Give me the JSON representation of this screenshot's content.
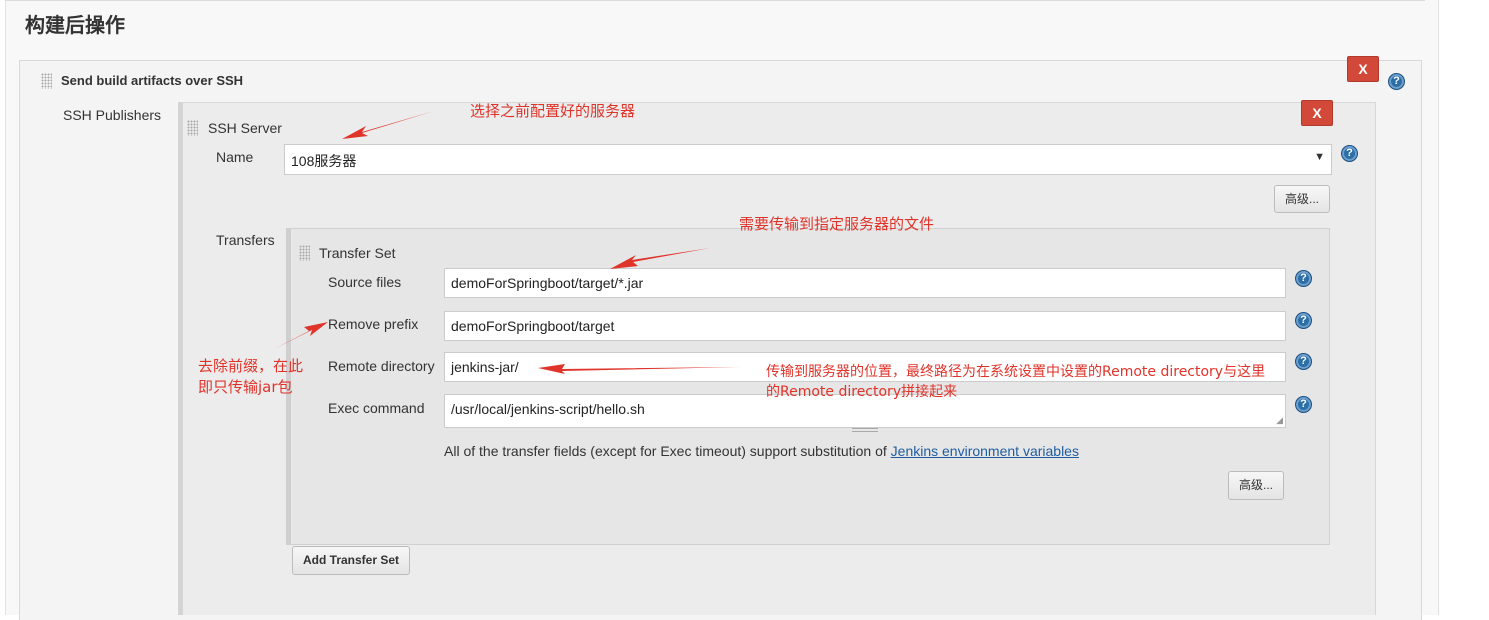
{
  "section": {
    "title": "构建后操作"
  },
  "publisher": {
    "title": "Send build artifacts over SSH",
    "delete_label": "X",
    "help_label": "?",
    "ssh_publishers_label": "SSH Publishers"
  },
  "ssh_server": {
    "title": "SSH Server",
    "delete_label": "X",
    "name_label": "Name",
    "name_value": "108服务器",
    "advanced_label": "高级...",
    "transfers_label": "Transfers"
  },
  "transfer_set": {
    "title": "Transfer Set",
    "source_files_label": "Source files",
    "source_files_value": "demoForSpringboot/target/*.jar",
    "remove_prefix_label": "Remove prefix",
    "remove_prefix_value": "demoForSpringboot/target",
    "remote_directory_label": "Remote directory",
    "remote_directory_value": "jenkins-jar/",
    "exec_command_label": "Exec command",
    "exec_command_value": "/usr/local/jenkins-script/hello.sh",
    "help_note_prefix": "All of the transfer fields (except for Exec timeout) support substitution of ",
    "help_note_link": "Jenkins environment variables",
    "advanced_label": "高级...",
    "add_transfer_set_label": "Add Transfer Set"
  },
  "annotations": {
    "server": "选择之前配置好的服务器",
    "files": "需要传输到指定服务器的文件",
    "prefix_line1": "去除前缀，在此",
    "prefix_line2": "即只传输jar包",
    "remote_line1": "传输到服务器的位置，最终路径为在系统设置中设置的Remote directory与这里",
    "remote_line2": "的Remote directory拼接起来"
  },
  "colors": {
    "delete_button": "#d24939",
    "annotation": "#e0332a",
    "help_icon": "#2c6ea6",
    "link": "#1f5da1"
  },
  "icons": [
    "drag-handle-icon",
    "help-icon",
    "dropdown-arrow-icon",
    "resize-grip-icon"
  ]
}
